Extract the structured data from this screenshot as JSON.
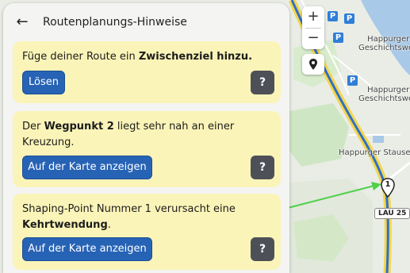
{
  "header": {
    "back_icon": "arrow-left-icon",
    "title": "Routenplanungs-Hinweise"
  },
  "hints": [
    {
      "text_plain": "Füge deiner Route ein ",
      "text_bold": "Zwischenziel hinzu.",
      "text_tail": "",
      "button": "Lösen",
      "help": "?"
    },
    {
      "text_plain": "Der ",
      "text_bold": "Wegpunkt 2",
      "text_tail": " liegt sehr nah an einer Kreuzung.",
      "button": "Auf der Karte anzeigen",
      "help": "?"
    },
    {
      "text_plain": "Shaping-Point Nummer 1 verursacht eine ",
      "text_bold": "Kehrtwendung",
      "text_tail": ".",
      "button": "Auf der Karte anzeigen",
      "help": "?"
    }
  ],
  "map": {
    "zoom_in": "+",
    "zoom_out": "−",
    "labels": {
      "place1_line1": "Happurger",
      "place1_line2": "Geschichtsweg",
      "place2_line1": "Happurger",
      "place2_line2": "Geschichtsweg",
      "place3": "Happurger Stausee"
    },
    "parking": "P",
    "waypoint_marker": "1",
    "road_sign": "LAU 25"
  },
  "colors": {
    "card_bg": "#fbf4b8",
    "button_blue": "#2763b5",
    "help_gray": "#4e5057",
    "route_blue": "#2e6fc7",
    "route_yellow": "#f2d64f",
    "arrow_green": "#4fd14a",
    "water": "#a8c9e8"
  }
}
